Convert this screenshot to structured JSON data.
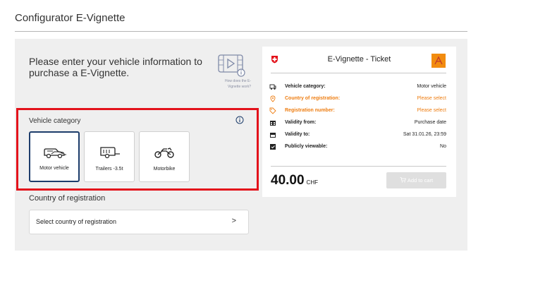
{
  "page": {
    "title": "Configurator E-Vignette"
  },
  "intro": {
    "text": "Please enter your vehicle information to purchase a E-Vignette.",
    "howto_caption_1": "How does the E-",
    "howto_caption_2": "Vignette work?"
  },
  "vehicle_category": {
    "label": "Vehicle category",
    "options": [
      {
        "label": "Motor vehicle",
        "icon": "car-caravan-icon",
        "selected": true
      },
      {
        "label": "Trailers -3.5t",
        "icon": "trailer-icon",
        "selected": false
      },
      {
        "label": "Motorbike",
        "icon": "motorbike-icon",
        "selected": false
      }
    ]
  },
  "country": {
    "label": "Country of registration",
    "placeholder": "Select country of registration",
    "chevron": ">"
  },
  "ticket": {
    "title": "E-Vignette - Ticket",
    "rows": [
      {
        "label": "Vehicle category:",
        "value": "Motor vehicle",
        "icon": "vehicle-icon",
        "warning": false
      },
      {
        "label": "Country of registration:",
        "value": "Please select",
        "icon": "location-pin-icon",
        "warning": true
      },
      {
        "label": "Registration number:",
        "value": "Please select",
        "icon": "tag-icon",
        "warning": true
      },
      {
        "label": "Validity from:",
        "value": "Purchase date",
        "icon": "calendar-icon",
        "warning": false
      },
      {
        "label": "Validity to:",
        "value": "Sat 31.01.26, 23:59",
        "icon": "calendar-end-icon",
        "warning": false
      },
      {
        "label": "Publicly viewable:",
        "value": "No",
        "icon": "checkbox-icon",
        "warning": false
      }
    ],
    "price": "40.00",
    "currency": "CHF",
    "cart_label": "Add to cart"
  },
  "colors": {
    "highlight_border": "#e3121b",
    "warning_text": "#ee7d11",
    "selected_border": "#1d3d6b",
    "swiss_red": "#e3121b"
  }
}
